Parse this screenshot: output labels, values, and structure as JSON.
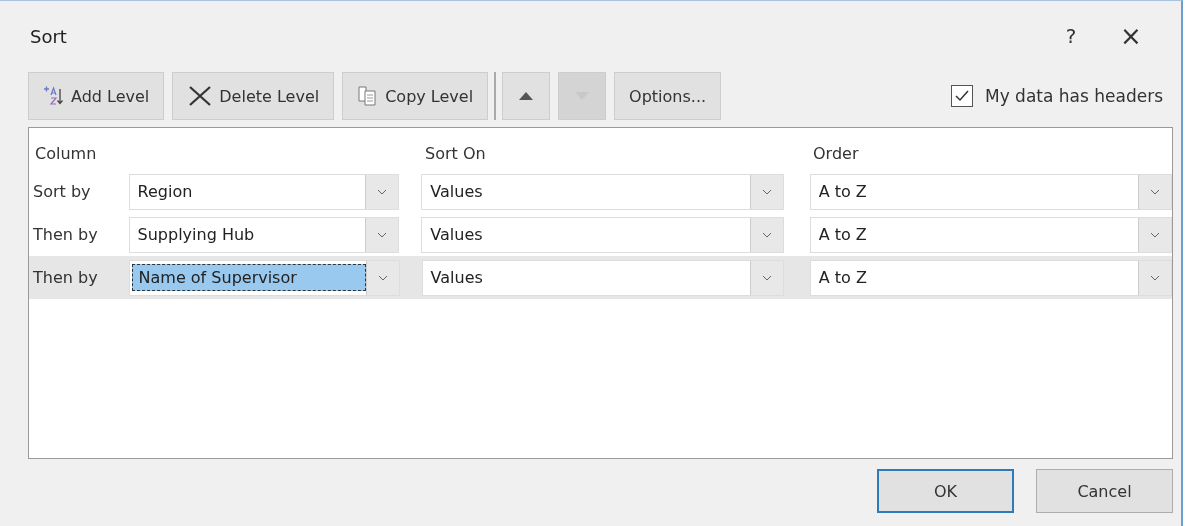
{
  "window": {
    "title": "Sort",
    "help": "?",
    "close": "×"
  },
  "toolbar": {
    "buttons": [
      {
        "kind": "add",
        "label": "Add Level",
        "disabled": false
      },
      {
        "kind": "delete",
        "label": "Delete Level",
        "disabled": false
      },
      {
        "kind": "copy",
        "label": "Copy Level",
        "disabled": false
      },
      {
        "kind": "up",
        "disabled": false
      },
      {
        "kind": "down",
        "disabled": true
      },
      {
        "kind": "text",
        "label": "Options...",
        "disabled": false
      }
    ],
    "headers_checkbox": {
      "label": "My data has headers",
      "checked": true
    }
  },
  "grid": {
    "columns": [
      "Column",
      "Sort On",
      "Order"
    ],
    "rows": [
      {
        "label": "Sort by",
        "column": "Region",
        "sort_on": "Values",
        "order": "A to Z",
        "selected": false
      },
      {
        "label": "Then by",
        "column": "Supplying Hub",
        "sort_on": "Values",
        "order": "A to Z",
        "selected": false
      },
      {
        "label": "Then by",
        "column": "Name of Supervisor",
        "sort_on": "Values",
        "order": "A to Z",
        "selected": true
      }
    ]
  },
  "buttons": [
    {
      "label": "OK",
      "default": true
    },
    {
      "label": "Cancel",
      "default": false
    }
  ]
}
